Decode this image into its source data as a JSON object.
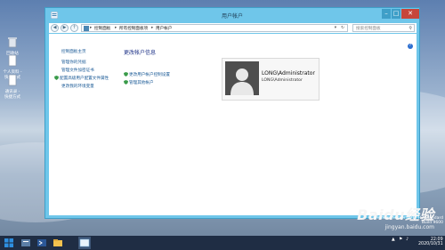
{
  "desktop": {
    "icons": [
      {
        "label": "回收站"
      },
      {
        "label": "个人资料 - 快捷方式"
      },
      {
        "label": "通讯录 - 快捷方式"
      }
    ]
  },
  "window": {
    "title": "用户帐户",
    "caption_min": "–",
    "caption_max": "□",
    "caption_close": "✕",
    "nav_back": "◀",
    "nav_forward": "▶",
    "nav_up": "↑",
    "breadcrumb": [
      "控制面板",
      "所有控制面板项",
      "用户帐户"
    ],
    "search_placeholder": "搜索控制面板"
  },
  "sidebar": {
    "links": [
      "控制面板主页",
      "管理你的凭据",
      "管理文件加密证书",
      "配置高级用户配置文件属性",
      "更改我的环境变量"
    ]
  },
  "main": {
    "heading": "更改帐户信息",
    "tasks": [
      "更改用户帐户控制设置",
      "管理其他帐户"
    ],
    "help": "?"
  },
  "user": {
    "name": "LONG\\Administrator",
    "sub": "LONG\\Administrator"
  },
  "watermark": {
    "brand": "Baidu经验",
    "url": "jingyan.baidu.com"
  },
  "system": {
    "edition": "Windows Server 2012 R2 Standard",
    "build": "Build 9600",
    "time": "22:09",
    "date": "2020/10/31"
  },
  "colors": {
    "window_frame": "#6fc6ea",
    "close": "#c7463b",
    "link": "#1a5a96",
    "heading": "#1e3287",
    "taskbar": "#1f2d44"
  }
}
